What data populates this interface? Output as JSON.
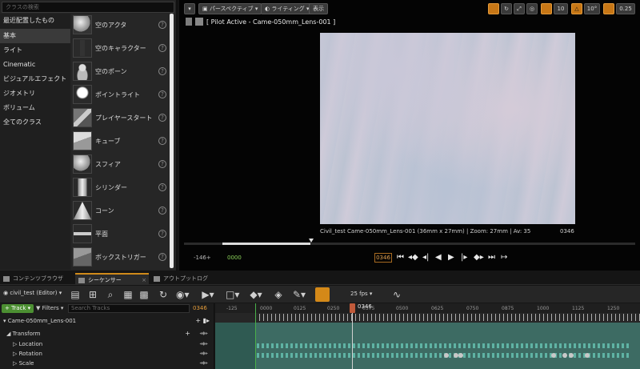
{
  "place_panel": {
    "search_placeholder": "クラスの検索",
    "categories": [
      {
        "label": "最近配置したもの"
      },
      {
        "label": "基本"
      },
      {
        "label": "ライト"
      },
      {
        "label": "Cinematic"
      },
      {
        "label": "ビジュアルエフェクト"
      },
      {
        "label": "ジオメトリ"
      },
      {
        "label": "ボリューム"
      },
      {
        "label": "全てのクラス"
      }
    ],
    "active_category": "基本",
    "actors": [
      {
        "label": "空のアクタ",
        "icon": "sphere-icon"
      },
      {
        "label": "空のキャラクター",
        "icon": "character-icon"
      },
      {
        "label": "空のポーン",
        "icon": "pawn-icon"
      },
      {
        "label": "ポイントライト",
        "icon": "bulb-icon"
      },
      {
        "label": "プレイヤースタート",
        "icon": "player-start-icon"
      },
      {
        "label": "キューブ",
        "icon": "cube-icon"
      },
      {
        "label": "スフィア",
        "icon": "sphere-icon"
      },
      {
        "label": "シリンダー",
        "icon": "cylinder-icon"
      },
      {
        "label": "コーン",
        "icon": "cone-icon"
      },
      {
        "label": "平面",
        "icon": "plane-icon"
      },
      {
        "label": "ボックストリガー",
        "icon": "box-trigger-icon"
      }
    ]
  },
  "viewport": {
    "perspective_label": "パースペクティブ",
    "lighting_label": "ライティング",
    "show_label": "表示",
    "pilot_label": "[ Pilot Active - Came-050mm_Lens-001 ]",
    "right_values": {
      "grid": "10",
      "angle": "10°"
    },
    "cam_info": "Civil_test  Came-050mm_Lens-001 (36mm x 27mm) | Zoom: 27mm | Av: 35",
    "cam_frame": "0346",
    "left_start": "-146+",
    "start_frame": "0000",
    "current_frame": "0346"
  },
  "tabs": [
    {
      "label": "コンテンツブラウザ",
      "active": false
    },
    {
      "label": "シーケンサー",
      "active": true
    },
    {
      "label": "アウトプットログ",
      "active": false
    }
  ],
  "sequencer": {
    "sequence_name": "civil_test (Editor)",
    "fps": "25 fps",
    "add_track": "+ Track ▾",
    "filters": "▼ Filters ▾",
    "search_placeholder": "Search Tracks",
    "frame_field": "0346",
    "playhead_label": "0346",
    "ruler_labels": [
      "-125",
      "0000",
      "0125",
      "0250",
      "0375",
      "0500",
      "0625",
      "0750",
      "0875",
      "1000",
      "1125",
      "1250"
    ],
    "tracks": [
      {
        "label": "Came-050mm_Lens-001",
        "indent": 0
      },
      {
        "label": "Transform",
        "indent": 1
      },
      {
        "label": "Location",
        "indent": 2
      },
      {
        "label": "Rotation",
        "indent": 2
      },
      {
        "label": "Scale",
        "indent": 2
      }
    ]
  },
  "colors": {
    "accent_orange": "#d48918",
    "track_green": "#3d6b63",
    "add_track_green": "#4c8f32"
  }
}
